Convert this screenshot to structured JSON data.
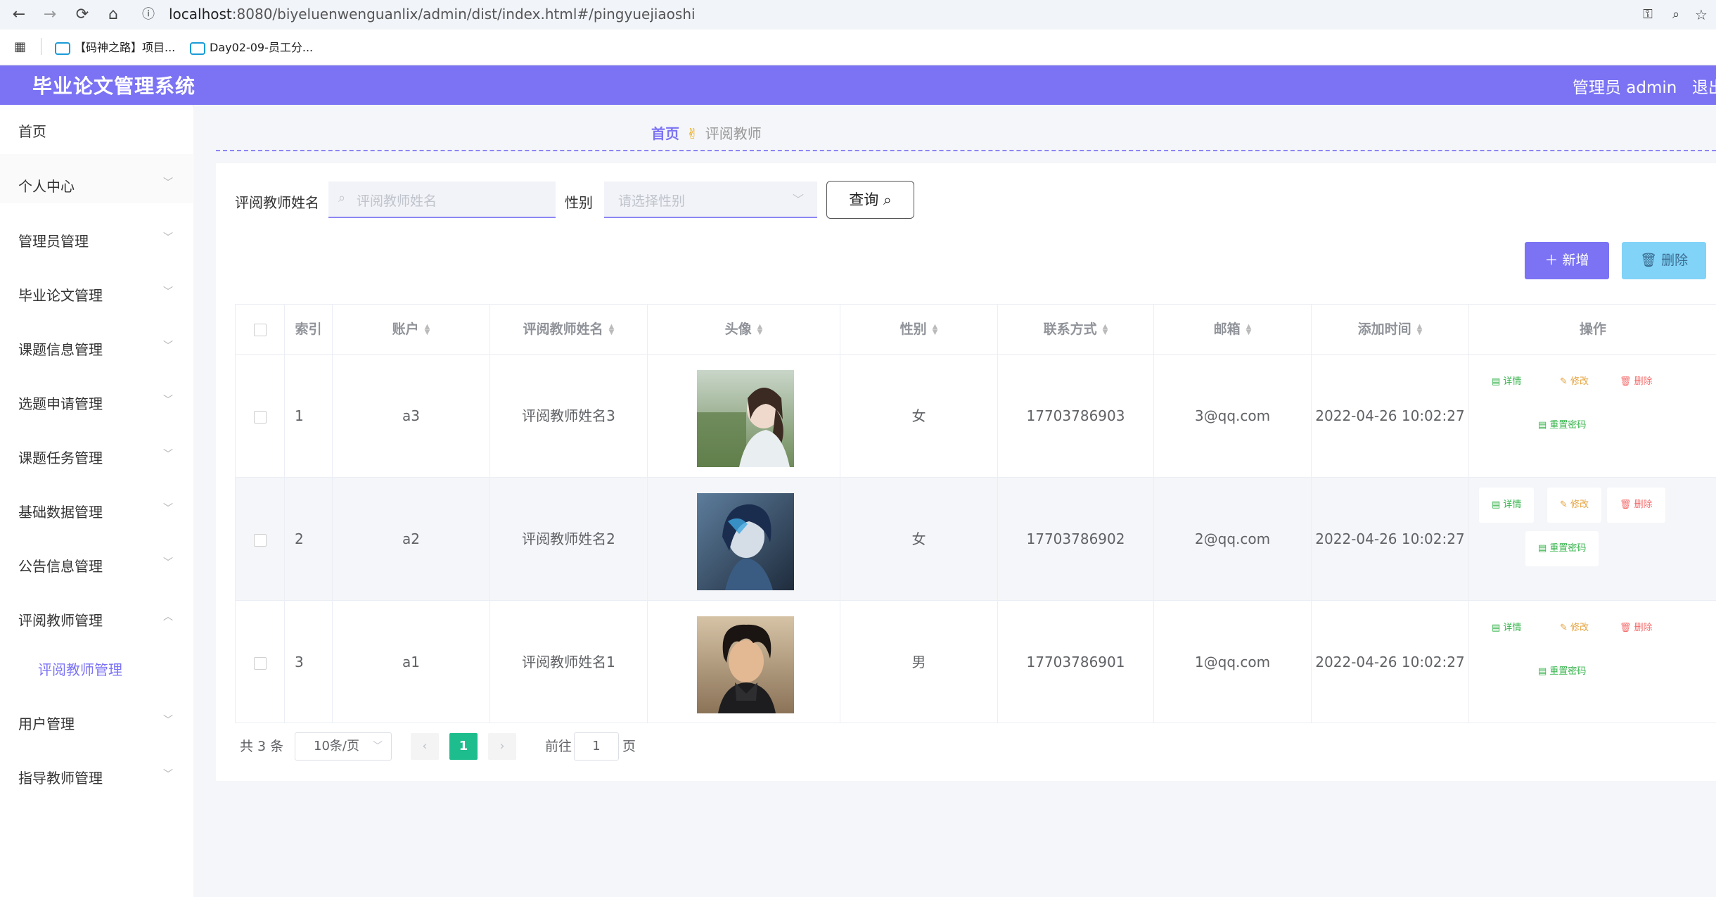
{
  "browser": {
    "url_host": "localhost",
    "url_rest": ":8080/biyeluenwenguanlix/admin/dist/index.html#/pingyuejiaoshi",
    "bookmarks": [
      "【码神之路】项目...",
      "Day02-09-员工分..."
    ]
  },
  "header": {
    "title": "毕业论文管理系统",
    "user": "管理员 admin",
    "logout": "退出"
  },
  "sidebar": {
    "items": [
      {
        "label": "首页"
      },
      {
        "label": "个人中心"
      },
      {
        "label": "管理员管理"
      },
      {
        "label": "毕业论文管理"
      },
      {
        "label": "课题信息管理"
      },
      {
        "label": "选题申请管理"
      },
      {
        "label": "课题任务管理"
      },
      {
        "label": "基础数据管理"
      },
      {
        "label": "公告信息管理"
      },
      {
        "label": "评阅教师管理"
      },
      {
        "label": "评阅教师管理"
      },
      {
        "label": "用户管理"
      },
      {
        "label": "指导教师管理"
      }
    ]
  },
  "breadcrumb": {
    "home": "首页",
    "current": "评阅教师"
  },
  "search": {
    "name_label": "评阅教师姓名",
    "name_placeholder": "评阅教师姓名",
    "gender_label": "性别",
    "gender_placeholder": "请选择性别",
    "query_button": "查询"
  },
  "toolbar": {
    "add": "新增",
    "delete": "删除"
  },
  "table": {
    "headers": [
      "索引",
      "账户",
      "评阅教师姓名",
      "头像",
      "性别",
      "联系方式",
      "邮箱",
      "添加时间",
      "操作"
    ],
    "rows": [
      {
        "index": "1",
        "account": "a3",
        "name": "评阅教师姓名3",
        "gender": "女",
        "phone": "17703786903",
        "email": "3@qq.com",
        "time": "2022-04-26 10:02:27"
      },
      {
        "index": "2",
        "account": "a2",
        "name": "评阅教师姓名2",
        "gender": "女",
        "phone": "17703786902",
        "email": "2@qq.com",
        "time": "2022-04-26 10:02:27"
      },
      {
        "index": "3",
        "account": "a1",
        "name": "评阅教师姓名1",
        "gender": "男",
        "phone": "17703786901",
        "email": "1@qq.com",
        "time": "2022-04-26 10:02:27"
      }
    ],
    "actions": {
      "detail": "详情",
      "edit": "修改",
      "delete": "删除",
      "reset": "重置密码"
    }
  },
  "pagination": {
    "total": "共 3 条",
    "page_size": "10条/页",
    "current": "1",
    "goto_prefix": "前往",
    "goto_value": "1",
    "goto_suffix": "页"
  },
  "colors": {
    "accent": "#7b73f4",
    "pager_active": "#1dbd8d",
    "delete_btn": "#81d3f8"
  }
}
